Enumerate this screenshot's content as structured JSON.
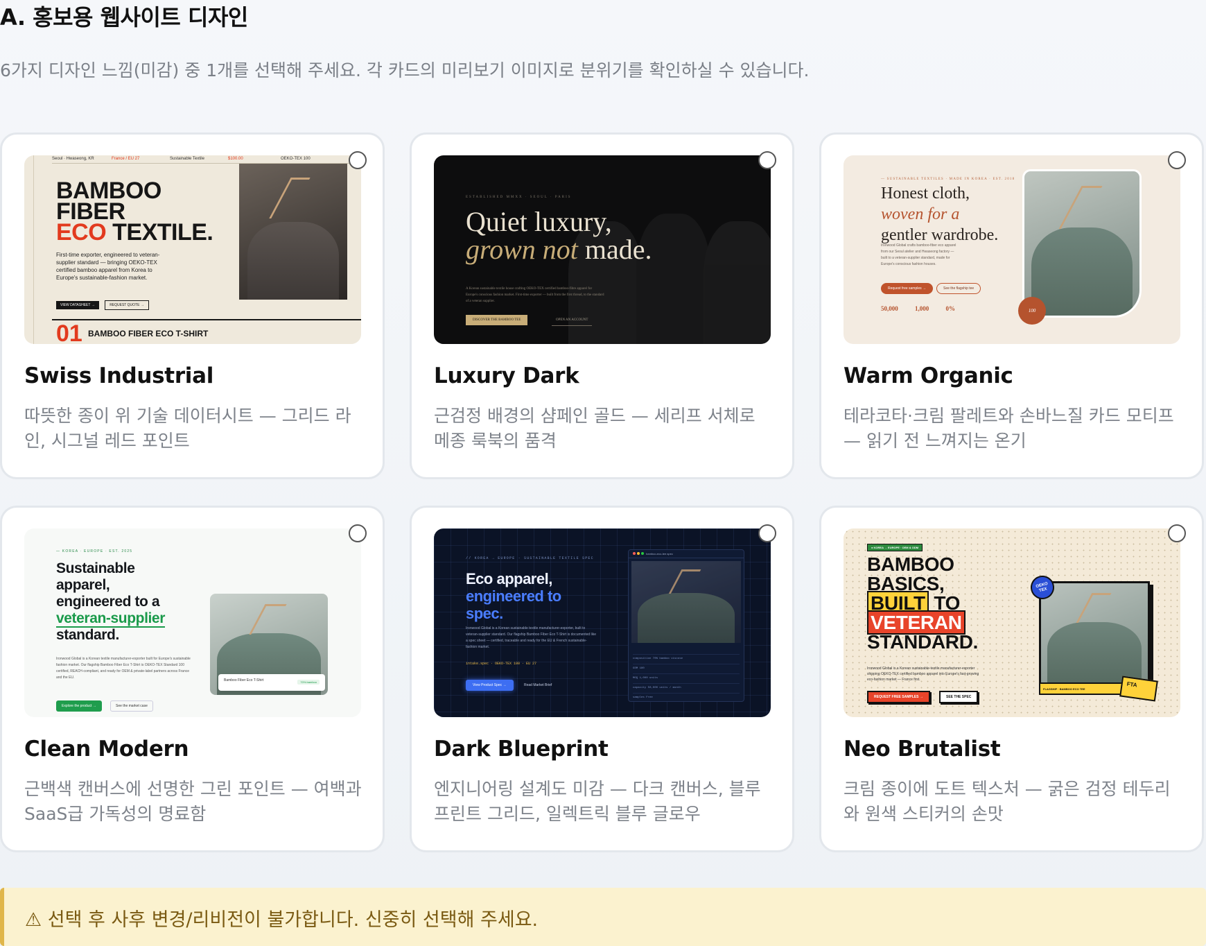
{
  "section": {
    "title": "A. 홍보용 웹사이트 디자인",
    "description": "6가지 디자인 느낌(미감) 중 1개를 선택해 주세요. 각 카드의 미리보기 이미지로 분위기를 확인하실 수 있습니다."
  },
  "cards": [
    {
      "title": "Swiss Industrial",
      "description": "따뜻한 종이 위 기술 데이터시트 — 그리드 라인, 시그널 레드 포인트",
      "selected": false,
      "preview": {
        "topbar": [
          "Seoul · Hwaseong, KR",
          "France / EU 27",
          "Sustainable Textile",
          "$100.00",
          "OEKO-TEX 100"
        ],
        "headline_1": "BAMBOO",
        "headline_2": "FIBER",
        "headline_3a": "ECO",
        "headline_3b": " TEXTILE.",
        "body": "First-time exporter, engineered to veteran-supplier standard — bringing OEKO-TEX certified bamboo apparel from Korea to Europe's sustainable-fashion market.",
        "btn_primary": "VIEW DATASHEET →",
        "btn_secondary": "REQUEST QUOTE →",
        "number": "01",
        "product": "BAMBOO FIBER ECO T-SHIRT"
      }
    },
    {
      "title": "Luxury Dark",
      "description": "근검정 배경의 샴페인 골드 — 세리프 서체로 메종 룩북의 품격",
      "selected": false,
      "preview": {
        "eyebrow": "ESTABLISHED MMXX · SEOUL · PARIS",
        "headline_1": "Quiet luxury,",
        "headline_2a": "grown not",
        "headline_2b": " made.",
        "body": "A Korean sustainable textile house crafting OEKO-TEX certified bamboo-fibre apparel for Europe's conscious fashion market. First-time exporter — built from the first thread, to the standard of a veteran supplier.",
        "btn_primary": "DISCOVER THE BAMBOO TEE",
        "btn_secondary": "OPEN AN ACCOUNT"
      }
    },
    {
      "title": "Warm Organic",
      "description": "테라코타·크림 팔레트와 손바느질 카드 모티프 — 읽기 전 느껴지는 온기",
      "selected": false,
      "preview": {
        "eyebrow": "— SUSTAINABLE TEXTILES · MADE IN KOREA · EST. 2018",
        "headline_1": "Honest cloth,",
        "headline_2": "woven for a",
        "headline_3": "gentler wardrobe.",
        "body": "Ironwood Global crafts bamboo-fiber eco apparel from our Seoul atelier and Hwaseong factory — built to a veteran-supplier standard, made for Europe's conscious fashion houses.",
        "btn_primary": "Request free samples →",
        "btn_secondary": "See the flagship tee",
        "stats": [
          "50,000",
          "1,000",
          "0%"
        ],
        "badge": "100"
      }
    },
    {
      "title": "Clean Modern",
      "description": "근백색 캔버스에 선명한 그린 포인트 — 여백과 SaaS급 가독성의 명료함",
      "selected": false,
      "preview": {
        "eyebrow": "— KOREA · EUROPE · EST. 2025",
        "headline_1": "Sustainable",
        "headline_2": "apparel,",
        "headline_3": "engineered to a",
        "headline_4": "veteran-supplier",
        "headline_5": "standard.",
        "body": "Ironwood Global is a Korean textile manufacturer-exporter built for Europe's sustainable fashion market. Our flagship Bamboo Fiber Eco T-Shirt is OEKO-TEX Standard 100 certified, REACH-compliant, and ready for OEM & private-label partners across France and the EU.",
        "btn_primary": "Explore the product →",
        "btn_secondary": "See the market case",
        "tag_label": "Bamboo Fiber Eco T-Shirt",
        "tag_chip": "70% bamboo"
      }
    },
    {
      "title": "Dark Blueprint",
      "description": "엔지니어링 설계도 미감 — 다크 캔버스, 블루프린트 그리드, 일렉트릭 블루 글로우",
      "selected": false,
      "preview": {
        "eyebrow": "// KOREA → EUROPE · SUSTAINABLE TEXTILE SPEC",
        "headline_1": "Eco apparel,",
        "headline_2": "engineered to",
        "headline_3": "spec.",
        "body": "Ironwood Global is a Korean sustainable textile manufacturer-exporter, built to veteran-supplier standard. Our flagship Bamboo Fiber Eco T-Shirt is documented like a spec sheet — certified, traceable and ready for the EU & French sustainable-fashion market.",
        "mono": "intake.spec · OEKO-TEX 100 · EU 27",
        "btn_primary": "View Product Spec →",
        "btn_secondary": "Read Market Brief",
        "panel_title": "bamboo-eco-tee.spec",
        "rows": [
          "composition  70% bamboo viscose",
          "GSM  180",
          "MOQ  1,000 units",
          "capacity  50,000 units / month",
          "samples  Free"
        ]
      }
    },
    {
      "title": "Neo Brutalist",
      "description": "크림 종이에 도트 텍스처 — 굵은 검정 테두리와 원색 스티커의 손맛",
      "selected": false,
      "preview": {
        "tag": "● KOREA → EUROPE · OEM & ODM",
        "headline_1": "BAMBOO",
        "headline_2": "BASICS,",
        "headline_3a": "BUILT",
        "headline_3b": " TO",
        "headline_4": "VETERAN",
        "headline_5": "STANDARD.",
        "body": "Ironwood Global is a Korean sustainable-textile manufacturer-exporter shipping OEKO-TEX certified bamboo apparel into Europe's fast-growing eco-fashion market — France first.",
        "btn_primary": "REQUEST FREE SAMPLES →",
        "btn_secondary": "SEE THE SPEC",
        "sticker": "OEKO TEX",
        "strip": "FLAGSHIP · BAMBOO ECO TEE",
        "fta": "FTA"
      }
    }
  ],
  "warning": "⚠ 선택 후 사후 변경/리비전이 불가합니다. 신중히 선택해 주세요."
}
